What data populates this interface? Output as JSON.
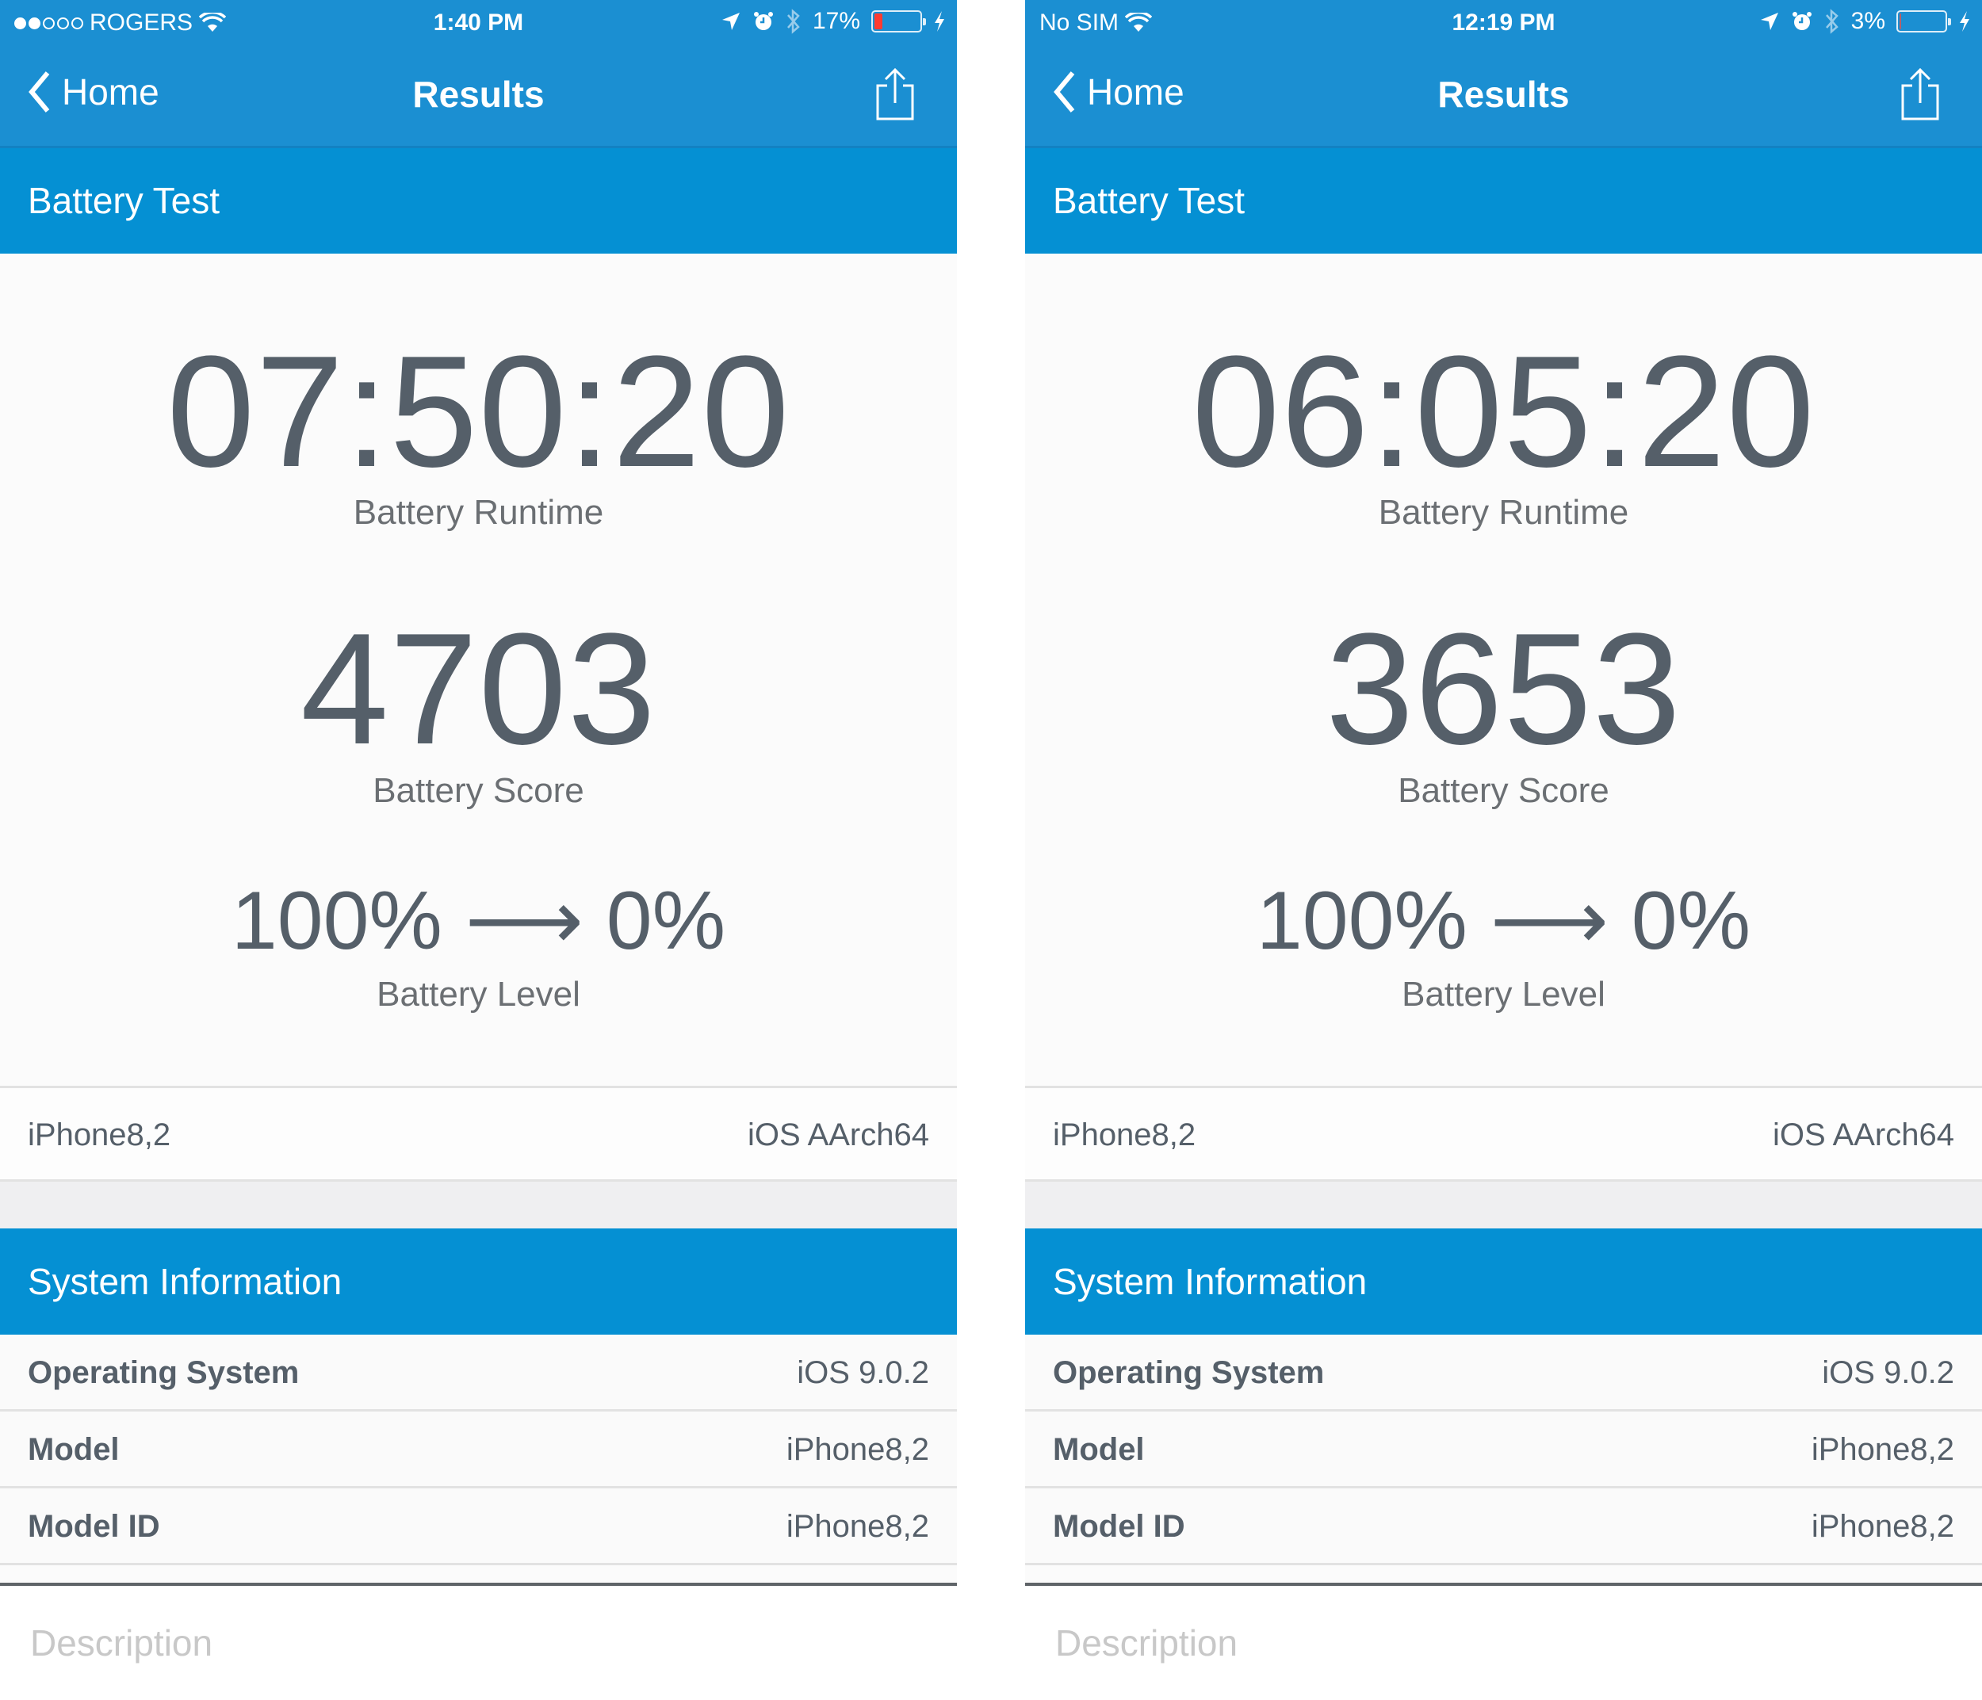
{
  "colors": {
    "nav_blue": "#1b8fd2",
    "header_blue": "#0590d3",
    "digit_gray": "#555f69",
    "battery_low_red": "#ff3b30"
  },
  "panels": [
    {
      "status": {
        "signal_bars_filled": 2,
        "signal_bars_total": 5,
        "carrier": "ROGERS",
        "wifi_icon": "wifi-icon",
        "time": "1:40 PM",
        "icons": [
          "location-arrow-icon",
          "alarm-clock-icon",
          "bluetooth-icon"
        ],
        "battery_percent_text": "17%",
        "battery_level": 0.17,
        "charging_icon": "bolt-icon"
      },
      "nav": {
        "back_label": "Home",
        "title": "Results",
        "share_icon": "share-icon"
      },
      "section_title": "Battery Test",
      "runtime": {
        "value": "07:50:20",
        "label": "Battery Runtime"
      },
      "score": {
        "value": "4703",
        "label": "Battery Score"
      },
      "level": {
        "from": "100%",
        "arrow": "⟶",
        "to": "0%",
        "label": "Battery Level"
      },
      "device": {
        "model": "iPhone8,2",
        "platform": "iOS AArch64"
      },
      "system_info": {
        "title": "System Information",
        "rows": [
          {
            "key": "Operating System",
            "value": "iOS 9.0.2"
          },
          {
            "key": "Model",
            "value": "iPhone8,2"
          },
          {
            "key": "Model ID",
            "value": "iPhone8,2"
          }
        ]
      },
      "description_placeholder": "Description"
    },
    {
      "status": {
        "carrier": "No SIM",
        "wifi_icon": "wifi-icon",
        "time": "12:19 PM",
        "icons": [
          "location-arrow-icon",
          "alarm-clock-icon",
          "bluetooth-icon"
        ],
        "battery_percent_text": "3%",
        "battery_level": 0.03,
        "charging_icon": "bolt-icon"
      },
      "nav": {
        "back_label": "Home",
        "title": "Results",
        "share_icon": "share-icon"
      },
      "section_title": "Battery Test",
      "runtime": {
        "value": "06:05:20",
        "label": "Battery Runtime"
      },
      "score": {
        "value": "3653",
        "label": "Battery Score"
      },
      "level": {
        "from": "100%",
        "arrow": "⟶",
        "to": "0%",
        "label": "Battery Level"
      },
      "device": {
        "model": "iPhone8,2",
        "platform": "iOS AArch64"
      },
      "system_info": {
        "title": "System Information",
        "rows": [
          {
            "key": "Operating System",
            "value": "iOS 9.0.2"
          },
          {
            "key": "Model",
            "value": "iPhone8,2"
          },
          {
            "key": "Model ID",
            "value": "iPhone8,2"
          }
        ]
      },
      "description_placeholder": "Description"
    }
  ]
}
